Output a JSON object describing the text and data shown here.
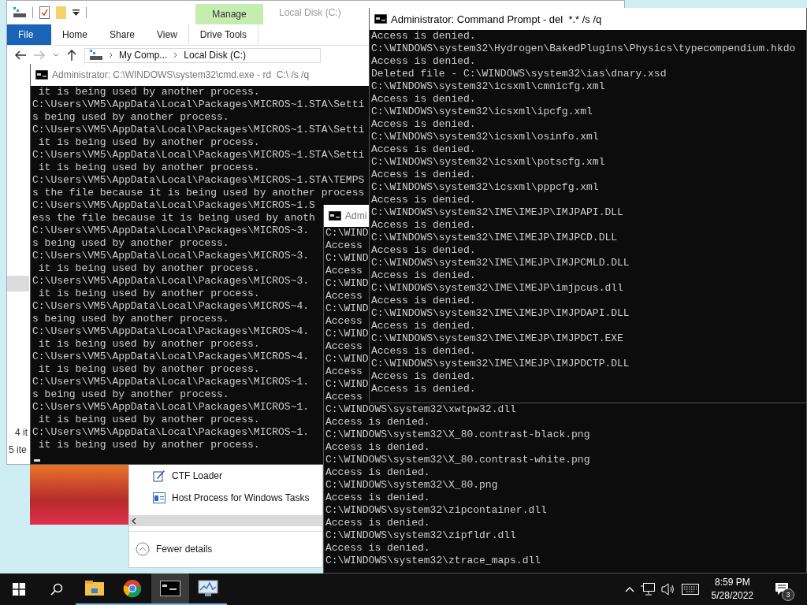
{
  "explorer": {
    "context_tab": "Manage",
    "title": "Local Disk (C:)",
    "ribbon_tabs": [
      {
        "label": "File",
        "kind": "file"
      },
      {
        "label": "Home",
        "kind": "plain"
      },
      {
        "label": "Share",
        "kind": "plain"
      },
      {
        "label": "View",
        "kind": "plain"
      },
      {
        "label": "Drive Tools",
        "kind": "context"
      }
    ],
    "crumbs": [
      "My Comp...",
      "Local Disk (C:)"
    ],
    "item_count": "4 it",
    "status": "5 ite"
  },
  "cmd_rd": {
    "title": "Administrator: C:\\WINDOWS\\system32\\cmd.exe - rd  C:\\ /s /q",
    "active": false,
    "lines": [
      " it is being used by another process.",
      "C:\\Users\\VM5\\AppData\\Local\\Packages\\MICROS~1.STA\\Setti",
      "s being used by another process.",
      "C:\\Users\\VM5\\AppData\\Local\\Packages\\MICROS~1.STA\\Setti",
      " it is being used by another process.",
      "C:\\Users\\VM5\\AppData\\Local\\Packages\\MICROS~1.STA\\Setti",
      " it is being used by another process.",
      "C:\\Users\\VM5\\AppData\\Local\\Packages\\MICROS~1.STA\\TEMPS",
      "s the file because it is being used by another process",
      "C:\\Users\\VM5\\AppData\\Local\\Packages\\MICROS~1.S",
      "ess the file because it is being used by anoth",
      "C:\\Users\\VM5\\AppData\\Local\\Packages\\MICROS~3.",
      "s being used by another process.",
      "C:\\Users\\VM5\\AppData\\Local\\Packages\\MICROS~3.",
      " it is being used by another process.",
      "C:\\Users\\VM5\\AppData\\Local\\Packages\\MICROS~3.",
      " it is being used by another process.",
      "C:\\Users\\VM5\\AppData\\Local\\Packages\\MICROS~4.",
      "s being used by another process.",
      "C:\\Users\\VM5\\AppData\\Local\\Packages\\MICROS~4.",
      " it is being used by another process.",
      "C:\\Users\\VM5\\AppData\\Local\\Packages\\MICROS~4.",
      " it is being used by another process.",
      "C:\\Users\\VM5\\AppData\\Local\\Packages\\MICROS~1.",
      "s being used by another process.",
      "C:\\Users\\VM5\\AppData\\Local\\Packages\\MICROS~1.",
      " it is being used by another process.",
      "C:\\Users\\VM5\\AppData\\Local\\Packages\\MICROS~1.",
      " it is being used by another process."
    ]
  },
  "cmd_mid": {
    "title": "Admi",
    "active": false,
    "lines": [
      "C:\\WIND",
      "Access",
      "C:\\WIND",
      "Access",
      "C:\\WIND",
      "Access",
      "C:\\WIND",
      "Access",
      "C:\\WIND",
      "Access",
      "C:\\WIND",
      "Access",
      "C:\\WIND",
      "Access",
      "C:\\WINDOWS\\system32\\xwtpw32.dll",
      "Access is denied.",
      "C:\\WINDOWS\\system32\\X_80.contrast-black.png",
      "Access is denied.",
      "C:\\WINDOWS\\system32\\X_80.contrast-white.png",
      "Access is denied.",
      "C:\\WINDOWS\\system32\\X_80.png",
      "Access is denied.",
      "C:\\WINDOWS\\system32\\zipcontainer.dll",
      "Access is denied.",
      "C:\\WINDOWS\\system32\\zipfldr.dll",
      "Access is denied.",
      "C:\\WINDOWS\\system32\\ztrace_maps.dll"
    ]
  },
  "cmd_del": {
    "title": "Administrator: Command Prompt - del  *.* /s /q",
    "active": true,
    "lines": [
      "Access is denied.",
      "C:\\WINDOWS\\system32\\Hydrogen\\BakedPlugins\\Physics\\typecompendium.hkdo",
      "Access is denied.",
      "Deleted file - C:\\WINDOWS\\system32\\ias\\dnary.xsd",
      "C:\\WINDOWS\\system32\\icsxml\\cmnicfg.xml",
      "Access is denied.",
      "C:\\WINDOWS\\system32\\icsxml\\ipcfg.xml",
      "Access is denied.",
      "C:\\WINDOWS\\system32\\icsxml\\osinfo.xml",
      "Access is denied.",
      "C:\\WINDOWS\\system32\\icsxml\\potscfg.xml",
      "Access is denied.",
      "C:\\WINDOWS\\system32\\icsxml\\pppcfg.xml",
      "Access is denied.",
      "C:\\WINDOWS\\system32\\IME\\IMEJP\\IMJPAPI.DLL",
      "Access is denied.",
      "C:\\WINDOWS\\system32\\IME\\IMEJP\\IMJPCD.DLL",
      "Access is denied.",
      "C:\\WINDOWS\\system32\\IME\\IMEJP\\IMJPCMLD.DLL",
      "Access is denied.",
      "C:\\WINDOWS\\system32\\IME\\IMEJP\\imjpcus.dll",
      "Access is denied.",
      "C:\\WINDOWS\\system32\\IME\\IMEJP\\IMJPDAPI.DLL",
      "Access is denied.",
      "C:\\WINDOWS\\system32\\IME\\IMEJP\\IMJPDCT.EXE",
      "Access is denied.",
      "C:\\WINDOWS\\system32\\IME\\IMEJP\\IMJPDCTP.DLL",
      "Access is denied.",
      "Access is denied."
    ]
  },
  "task_manager": {
    "processes": [
      {
        "name": "CTF Loader",
        "kind": "pen"
      },
      {
        "name": "Host Process for Windows Tasks",
        "kind": "window"
      }
    ],
    "fewer_details": "Fewer details"
  },
  "taskbar": {
    "apps": [
      {
        "kind": "folder",
        "active": false
      },
      {
        "kind": "browser",
        "active": false
      },
      {
        "kind": "terminal",
        "active": true
      },
      {
        "kind": "monitor",
        "active": false
      }
    ],
    "time": "8:59 PM",
    "date": "5/28/2022",
    "notifications": "3"
  }
}
